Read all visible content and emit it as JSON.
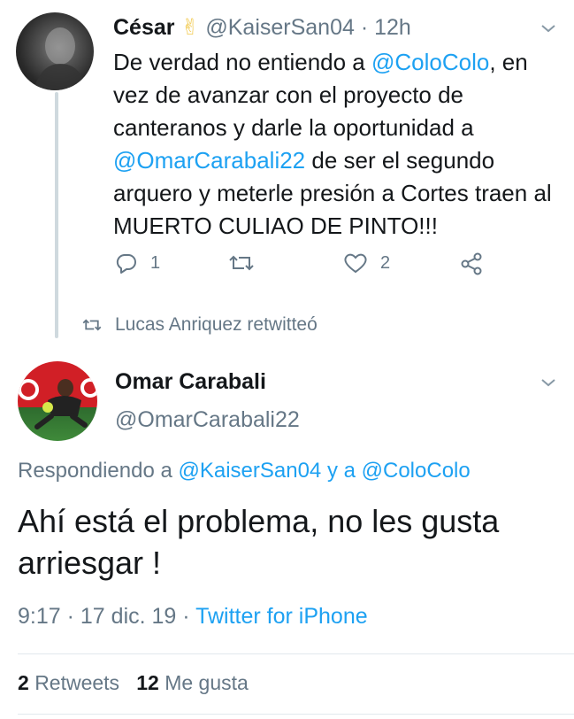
{
  "top_tweet": {
    "author_name": "César",
    "emoji": "✌",
    "handle": "@KaiserSan04",
    "separator": "·",
    "time": "12h",
    "text_segments": [
      {
        "text": "De verdad no entiendo a ",
        "link": false
      },
      {
        "text": "@ColoColo",
        "link": true
      },
      {
        "text": ", en vez de avanzar con el proyecto de canteranos y darle la oportunidad a ",
        "link": false
      },
      {
        "text": "@OmarCarabali22",
        "link": true
      },
      {
        "text": " de ser el segundo arquero y meterle presión a Cortes traen al MUERTO CULIAO DE PINTO!!!",
        "link": false
      }
    ],
    "actions": {
      "reply_count": "1",
      "retweet_count": "",
      "like_count": "2"
    }
  },
  "retweet_notice": {
    "text": "Lucas Anriquez retwitteó"
  },
  "main_tweet": {
    "author_name": "Omar Carabali",
    "handle": "@OmarCarabali22",
    "reply_prefix": "Respondiendo a ",
    "reply_user1": "@KaiserSan04",
    "reply_joiner": " y a ",
    "reply_user2": "@ColoColo",
    "text": "Ahí está el problema, no les gusta arriesgar !",
    "time": "9:17",
    "date": "17 dic. 19",
    "dot": "·",
    "source": "Twitter for iPhone",
    "retweets_count": "2",
    "retweets_label": "Retweets",
    "likes_count": "12",
    "likes_label": "Me gusta"
  },
  "colors": {
    "link": "#1da1f2",
    "secondary": "#657786",
    "text": "#14171a",
    "divider": "#e1e8ed"
  }
}
